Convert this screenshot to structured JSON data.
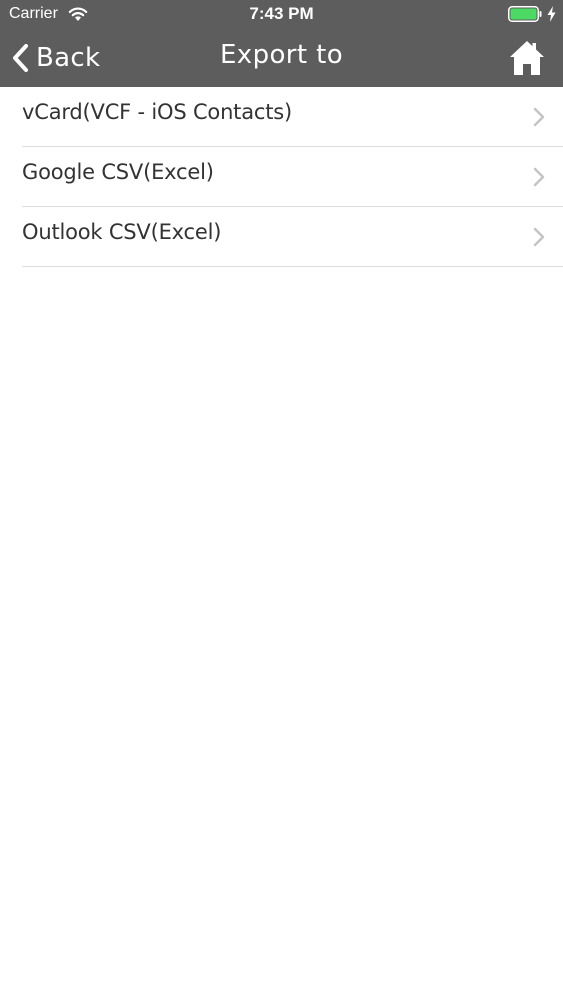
{
  "status_bar": {
    "carrier": "Carrier",
    "time": "7:43 PM",
    "wifi_icon": "wifi-icon",
    "battery_icon": "battery-icon",
    "battery_color": "#4cd964",
    "charging_icon": "lightning-bolt-icon"
  },
  "nav": {
    "back_label": "Back",
    "back_icon": "chevron-left-icon",
    "title": "Export to",
    "home_icon": "home-icon",
    "background_color": "#5e5d5e"
  },
  "export_options": [
    {
      "label": "vCard(VCF - iOS Contacts)",
      "icon": "chevron-right-icon"
    },
    {
      "label": "Google CSV(Excel)",
      "icon": "chevron-right-icon"
    },
    {
      "label": "Outlook CSV(Excel)",
      "icon": "chevron-right-icon"
    }
  ]
}
